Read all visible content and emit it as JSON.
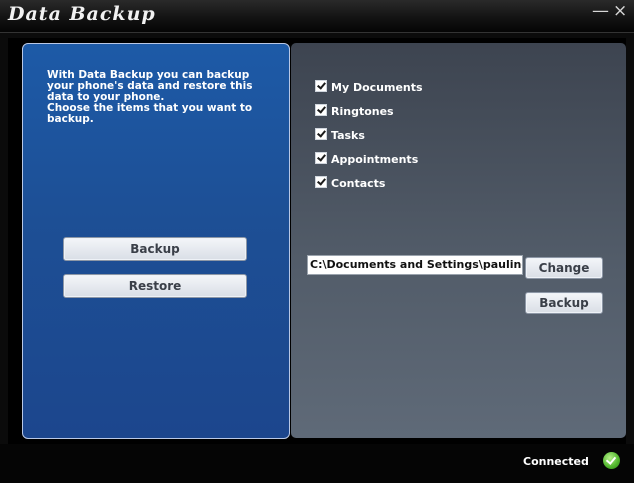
{
  "window": {
    "title": "Data Backup",
    "minimize_label": "—",
    "close_label": "×"
  },
  "left_panel": {
    "intro_text": "With Data Backup you can backup your phone's data and restore this data to your phone.\nChoose the items that you want to backup.",
    "backup_label": "Backup",
    "restore_label": "Restore"
  },
  "right_panel": {
    "items": [
      {
        "label": "My Documents",
        "checked": true
      },
      {
        "label": "Ringtones",
        "checked": true
      },
      {
        "label": "Tasks",
        "checked": true
      },
      {
        "label": "Appointments",
        "checked": true
      },
      {
        "label": "Contacts",
        "checked": true
      }
    ],
    "path_value": "C:\\Documents and Settings\\pauline.tsai\\",
    "change_label": "Change",
    "backup_label": "Backup"
  },
  "status": {
    "text": "Connected",
    "icon": "check-circle-icon"
  },
  "colors": {
    "left_panel": "#1d5aa7",
    "right_panel": "#4b5460",
    "title_bar": "#1a1a1a",
    "status_ok": "#4fb42b"
  }
}
